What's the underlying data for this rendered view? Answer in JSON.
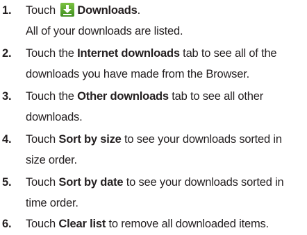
{
  "steps": [
    {
      "number": "1.",
      "line1": {
        "pre": "Touch ",
        "bold": "Downloads",
        "post": "."
      },
      "line2": "All of your downloads are listed."
    },
    {
      "number": "2.",
      "line1": {
        "pre": "Touch the ",
        "bold": "Internet downloads",
        "post": " tab to see all of the"
      },
      "line2": "downloads you have made from the Browser."
    },
    {
      "number": "3.",
      "line1": {
        "pre": "Touch the ",
        "bold": "Other downloads",
        "post": " tab to see all other"
      },
      "line2": "downloads."
    },
    {
      "number": "4.",
      "line1": {
        "pre": "Touch ",
        "bold": "Sort by size",
        "post": " to see your downloads sorted in"
      },
      "line2": "size order."
    },
    {
      "number": "5.",
      "line1": {
        "pre": "Touch ",
        "bold": "Sort by date",
        "post": " to see your downloads sorted in"
      },
      "line2": "time order."
    },
    {
      "number": "6.",
      "line1": {
        "pre": "Touch ",
        "bold": "Clear list",
        "post": " to remove all downloaded items."
      }
    }
  ],
  "icons": {
    "downloads": "download-arrow-icon",
    "downloads_color": "#5aa832"
  }
}
